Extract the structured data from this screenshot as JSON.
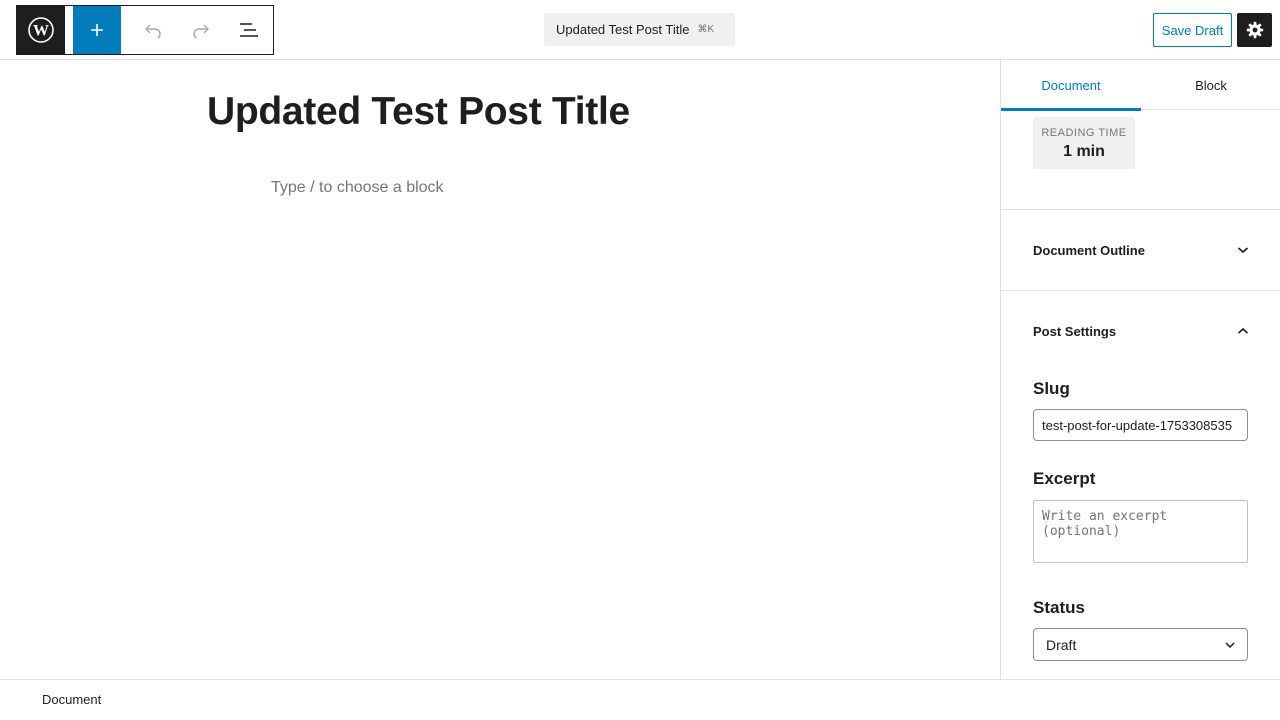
{
  "header": {
    "document_title": "Updated Test Post Title",
    "shortcut": "⌘K",
    "save_draft_label": "Save Draft"
  },
  "icons": {
    "logo": "wordpress-logo-icon",
    "add": "plus-icon",
    "undo": "undo-icon",
    "redo": "redo-icon",
    "list_view": "list-view-icon",
    "settings": "gear-icon",
    "chevron_down": "chevron-down-icon",
    "chevron_up": "chevron-up-icon"
  },
  "colors": {
    "accent": "#007cba",
    "dark": "#1e1e1e"
  },
  "editor": {
    "post_title": "Updated Test Post Title",
    "block_placeholder": "Type / to choose a block"
  },
  "sidebar": {
    "tabs": [
      {
        "label": "Document",
        "active": true
      },
      {
        "label": "Block",
        "active": false
      }
    ],
    "reading_time": {
      "label": "READING TIME",
      "value": "1 min"
    },
    "panels": {
      "outline_title": "Document Outline",
      "post_settings_title": "Post Settings"
    },
    "fields": {
      "slug_label": "Slug",
      "slug_value": "test-post-for-update-1753308535",
      "excerpt_label": "Excerpt",
      "excerpt_placeholder": "Write an excerpt (optional)",
      "status_label": "Status",
      "status_value": "Draft"
    }
  },
  "footer": {
    "breadcrumb": "Document"
  }
}
